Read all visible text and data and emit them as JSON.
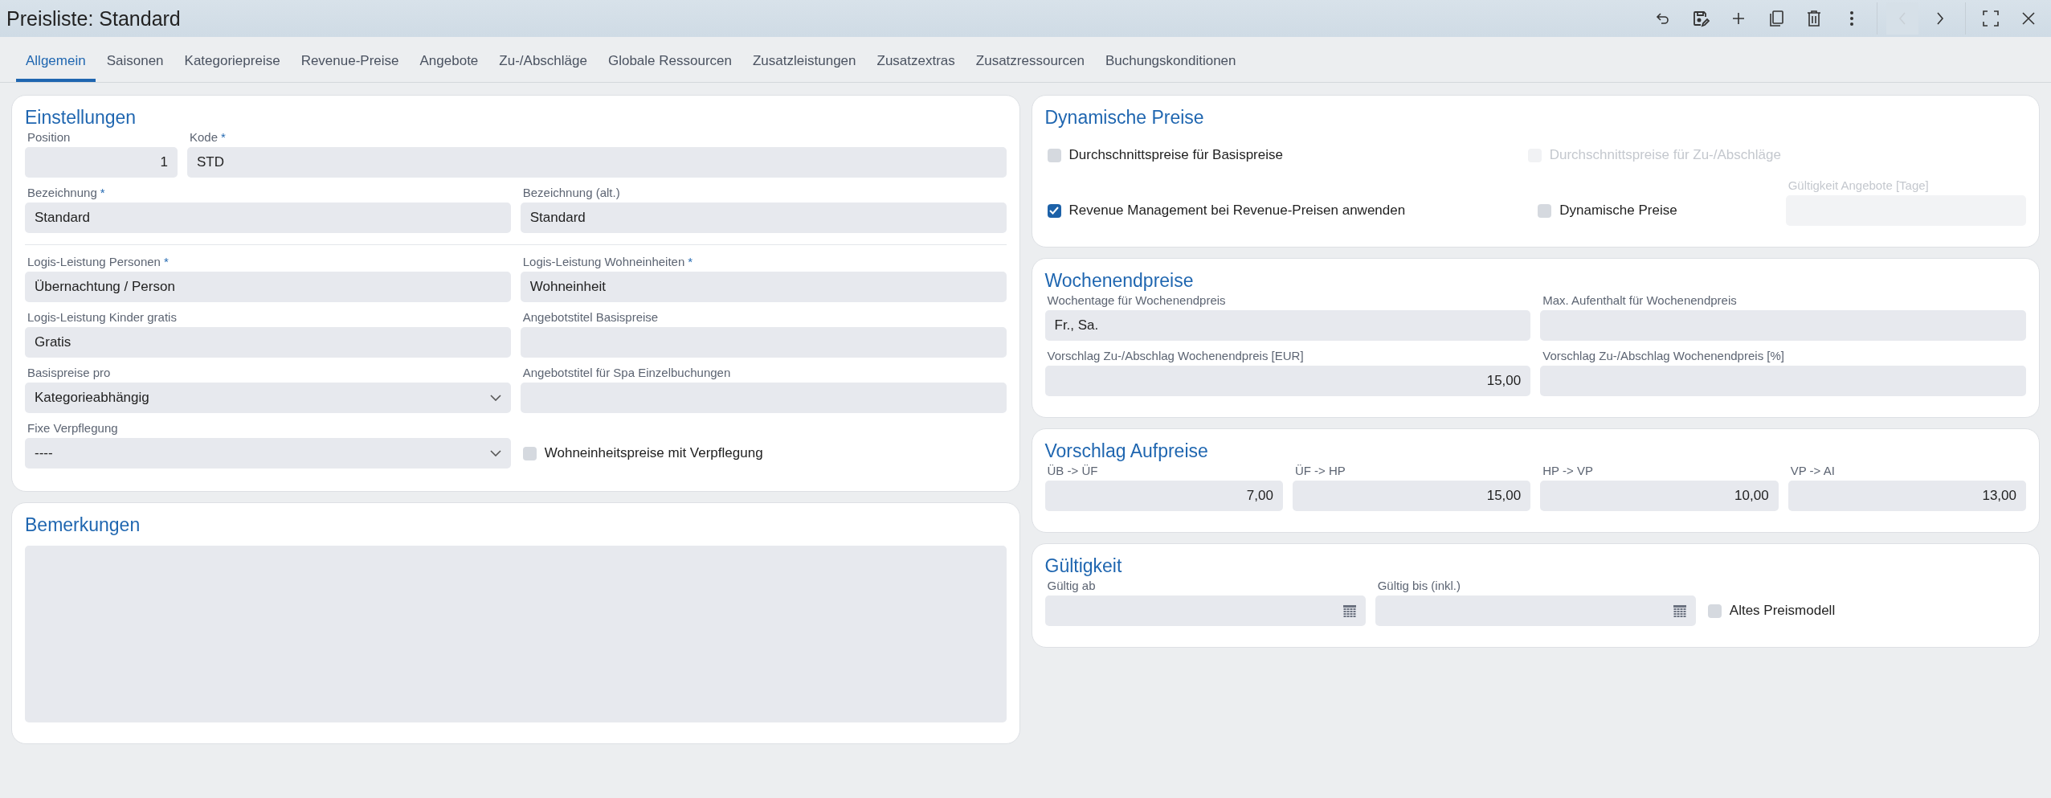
{
  "window": {
    "title": "Preisliste: Standard"
  },
  "toolbar": [
    {
      "kind": "undo",
      "disabled": false
    },
    {
      "kind": "save",
      "disabled": false
    },
    {
      "kind": "add",
      "disabled": false
    },
    {
      "kind": "copy",
      "disabled": false
    },
    {
      "kind": "delete",
      "disabled": false
    },
    {
      "kind": "more",
      "disabled": false
    },
    {
      "kind": "prev",
      "disabled": true
    },
    {
      "kind": "next",
      "disabled": false
    },
    {
      "kind": "fullscreen",
      "disabled": false
    },
    {
      "kind": "close",
      "disabled": false
    }
  ],
  "tabs": [
    {
      "label": "Allgemein",
      "selected": true
    },
    {
      "label": "Saisonen",
      "selected": false
    },
    {
      "label": "Kategoriepreise",
      "selected": false
    },
    {
      "label": "Revenue-Preise",
      "selected": false
    },
    {
      "label": "Angebote",
      "selected": false
    },
    {
      "label": "Zu-/Abschläge",
      "selected": false
    },
    {
      "label": "Globale Ressourcen",
      "selected": false
    },
    {
      "label": "Zusatzleistungen",
      "selected": false
    },
    {
      "label": "Zusatzextras",
      "selected": false
    },
    {
      "label": "Zusatzressourcen",
      "selected": false
    },
    {
      "label": "Buchungskonditionen",
      "selected": false
    }
  ],
  "left": [
    {
      "title": "Einstellungen",
      "groups": [
        {
          "rows": [
            [
              {
                "kind": "number",
                "label": "Position",
                "value": "1"
              },
              {
                "kind": "input",
                "label": "Kode",
                "mark": "*",
                "value": "STD"
              }
            ],
            [
              {
                "kind": "input",
                "label": "Bezeichnung",
                "mark": "*",
                "value": "Standard"
              },
              {
                "kind": "input",
                "label": "Bezeichnung (alt.)",
                "value": "Standard"
              }
            ]
          ]
        },
        {
          "rows": [
            [
              {
                "kind": "input",
                "label": "Logis-Leistung Personen",
                "mark": "*",
                "value": "Übernachtung / Person"
              },
              {
                "kind": "input",
                "label": "Logis-Leistung Wohneinheiten",
                "mark": "*",
                "value": "Wohneinheit"
              }
            ],
            [
              {
                "kind": "input",
                "label": "Logis-Leistung Kinder gratis",
                "value": "Gratis"
              },
              {
                "kind": "input",
                "label": "Angebotstitel Basispreise"
              }
            ],
            [
              {
                "kind": "select",
                "label": "Basispreise pro",
                "value": "Kategorieabhängig"
              },
              {
                "kind": "input",
                "label": "Angebotstitel für Spa Einzelbuchungen"
              }
            ],
            [
              {
                "kind": "select",
                "label": "Fixe Verpflegung",
                "value": "----"
              },
              {
                "kind": "checkbox",
                "label": "Wohneinheitspreise mit Verpflegung",
                "checked": false,
                "disabled": false
              }
            ]
          ]
        }
      ]
    },
    {
      "title": "Bemerkungen",
      "groups": [
        {
          "rows": [
            [
              {
                "kind": "textarea"
              }
            ]
          ]
        }
      ]
    }
  ],
  "right": [
    {
      "title": "Dynamische Preise",
      "groups": [
        {
          "rows": [
            [
              {
                "kind": "checkbox",
                "label": "Durchschnittspreise für Basispreise",
                "checked": false,
                "disabled": false
              },
              {
                "kind": "checkbox",
                "label": "Durchschnittspreise für Zu-/Abschläge",
                "checked": false,
                "disabled": true
              }
            ],
            [
              {
                "kind": "checkbox",
                "label": "Revenue Management bei Revenue-Preisen anwenden",
                "checked": true,
                "disabled": false
              },
              {
                "kind": "checkbox",
                "label": "Dynamische Preise",
                "checked": false,
                "disabled": false
              },
              {
                "kind": "input",
                "label": "Gültigkeit Angebote [Tage]",
                "disabled": true
              }
            ]
          ]
        }
      ]
    },
    {
      "title": "Wochenendpreise",
      "groups": [
        {
          "rows": [
            [
              {
                "kind": "input",
                "label": "Wochentage für Wochenendpreis",
                "value": "Fr., Sa."
              },
              {
                "kind": "input",
                "label": "Max. Aufenthalt für Wochenendpreis"
              }
            ],
            [
              {
                "kind": "number",
                "label": "Vorschlag Zu-/Abschlag Wochenendpreis [EUR]",
                "value": "15,00"
              },
              {
                "kind": "number",
                "label": "Vorschlag Zu-/Abschlag Wochenendpreis [%]"
              }
            ]
          ]
        }
      ]
    },
    {
      "title": "Vorschlag Aufpreise",
      "groups": [
        {
          "rows": [
            [
              {
                "kind": "number",
                "label": "ÜB -> ÜF",
                "value": "7,00"
              },
              {
                "kind": "number",
                "label": "ÜF -> HP",
                "value": "15,00"
              },
              {
                "kind": "number",
                "label": "HP -> VP",
                "value": "10,00"
              },
              {
                "kind": "number",
                "label": "VP -> AI",
                "value": "13,00"
              }
            ]
          ]
        }
      ]
    },
    {
      "title": "Gültigkeit",
      "groups": [
        {
          "rows": [
            [
              {
                "kind": "date",
                "label": "Gültig ab"
              },
              {
                "kind": "date",
                "label": "Gültig bis (inkl.)"
              },
              {
                "kind": "checkbox",
                "label": "Altes Preismodell",
                "checked": false,
                "disabled": false
              }
            ]
          ]
        }
      ]
    }
  ]
}
